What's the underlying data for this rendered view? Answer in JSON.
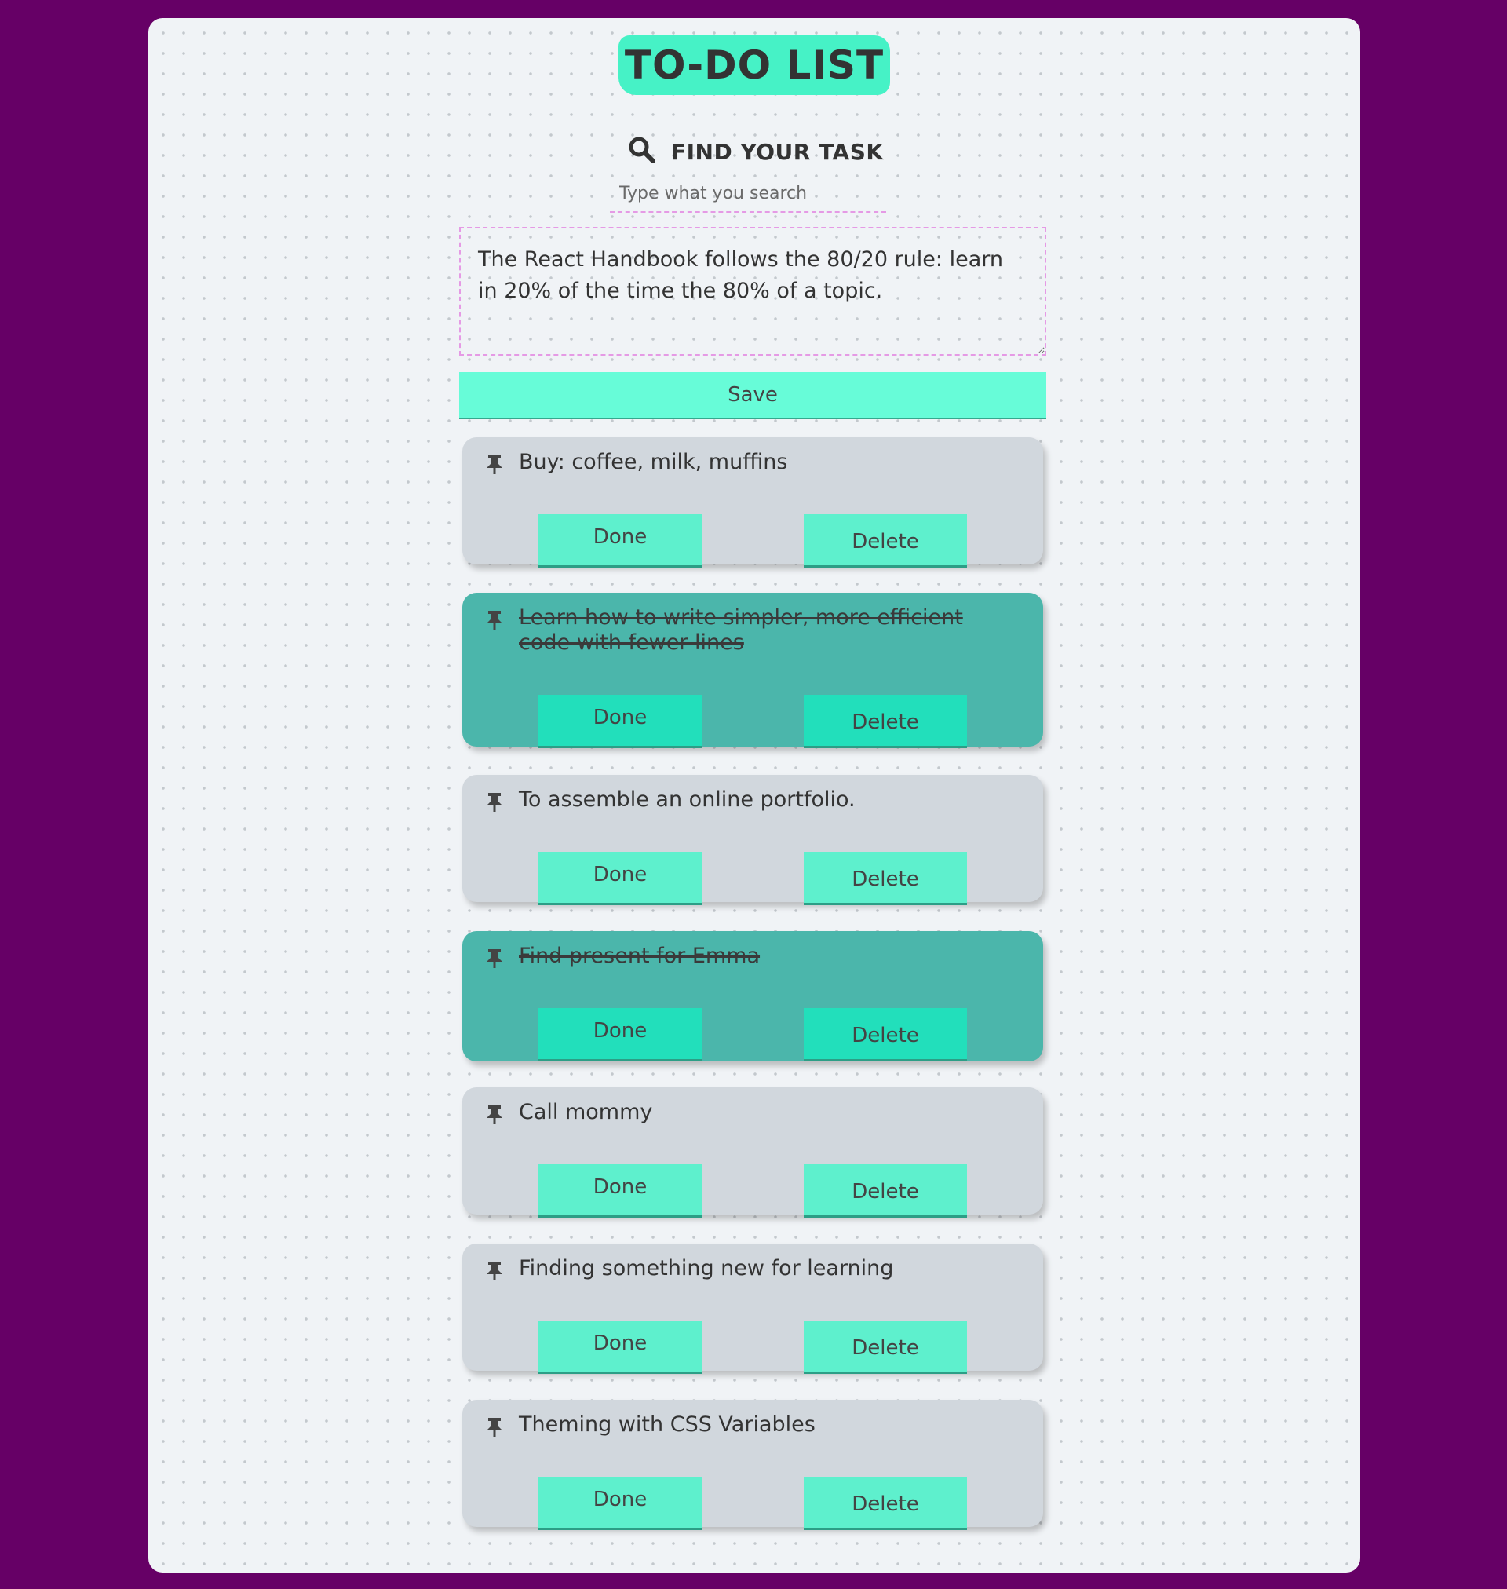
{
  "app": {
    "title": "TO-DO LIST"
  },
  "search": {
    "label": "FIND YOUR TASK",
    "placeholder": "Type what you search",
    "value": ""
  },
  "editor": {
    "value": "The React Handbook follows the 80/20 rule: learn in 20% of the time the 80% of a topic."
  },
  "actions": {
    "save_label": "Save",
    "done_label": "Done",
    "delete_label": "Delete"
  },
  "todos": [
    {
      "text": "Buy: coffee, milk, muffins",
      "completed": false
    },
    {
      "text": "Learn how to write simpler, more efficient code with fewer lines",
      "completed": true
    },
    {
      "text": "To assemble an online portfolio.",
      "completed": false
    },
    {
      "text": "Find present for Emma",
      "completed": true
    },
    {
      "text": "Call mommy",
      "completed": false
    },
    {
      "text": "Finding something new for learning",
      "completed": false
    },
    {
      "text": "Theming with CSS Variables",
      "completed": false
    }
  ],
  "icons": {
    "search": "search-icon",
    "pin": "pin-icon"
  },
  "colors": {
    "background": "#660066",
    "panel": "#f0f3f6",
    "accent": "#46f2c6",
    "card": "#d1d7dd",
    "card_completed": "#4bb6ab",
    "button": "#5ef0cd",
    "button_completed": "#22dfbb",
    "dashed_border": "#e59ae5"
  }
}
